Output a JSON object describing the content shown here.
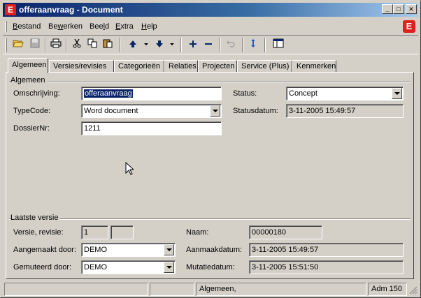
{
  "window": {
    "title": "offeraanvraag - Document",
    "app_icon": "E",
    "controls": {
      "minimize": "_",
      "maximize": "□",
      "close": "✕"
    },
    "accent": "#0a246a",
    "brand_color": "#e0201c"
  },
  "menu": {
    "items": [
      {
        "pre": "",
        "key": "B",
        "post": "estand"
      },
      {
        "pre": "Be",
        "key": "w",
        "post": "erken"
      },
      {
        "pre": "Bee",
        "key": "l",
        "post": "d"
      },
      {
        "pre": "",
        "key": "E",
        "post": "xtra"
      },
      {
        "pre": "",
        "key": "H",
        "post": "elp"
      }
    ],
    "brand_icon": "E"
  },
  "toolbar": {
    "icons": [
      "open-folder-icon",
      "save-icon",
      "print-icon",
      "cut-icon",
      "copy-icon",
      "paste-icon",
      "arrow-up-icon",
      "arrow-down-icon",
      "add-icon",
      "remove-icon",
      "undo-icon",
      "refresh-icon",
      "layout-icon"
    ]
  },
  "tabs": [
    "Algemeen",
    "Versies/revisies",
    "Categorieën",
    "Relaties",
    "Projecten",
    "Service (Plus)",
    "Kenmerken"
  ],
  "general": {
    "group_title": "Algemeen",
    "omschrijving_label": "Omschrijving:",
    "omschrijving_value": "offeraanvraag",
    "typecode_label": "TypeCode:",
    "typecode_value": "Word document",
    "dossiernr_label": "DossierNr:",
    "dossiernr_value": "1211",
    "status_label": "Status:",
    "status_value": "Concept",
    "statusdatum_label": "Statusdatum:",
    "statusdatum_value": "3-11-2005 15:49:57"
  },
  "latest": {
    "group_title": "Laatste versie",
    "versie_label": "Versie,  revisie:",
    "versie_value": "1",
    "revisie_value": "",
    "naam_label": "Naam:",
    "naam_value": "00000180",
    "aangemaakt_label": "Aangemaakt door:",
    "aangemaakt_value": "DEMO",
    "aanmaakdatum_label": "Aanmaakdatum:",
    "aanmaakdatum_value": "3-11-2005 15:49:57",
    "gemuteerd_label": "Gemuteerd door:",
    "gemuteerd_value": "DEMO",
    "mutatiedatum_label": "Mutatiedatum:",
    "mutatiedatum_value": "3-11-2005 15:51:50"
  },
  "statusbar": {
    "panel1": "",
    "panel2": "",
    "panel3": "Algemeen,",
    "panel4": "Adm 150"
  }
}
